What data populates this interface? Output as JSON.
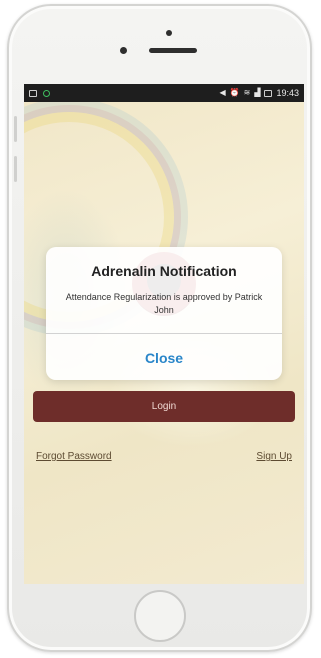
{
  "status_bar": {
    "time": "19:43",
    "left_icons": [
      "image-icon",
      "notification-icon"
    ],
    "right_icons": [
      "volume-icon",
      "alarm-icon",
      "wifi-icon",
      "signal-icon",
      "battery-icon"
    ]
  },
  "dialog": {
    "title": "Adrenalin Notification",
    "message": "Attendance Regularization is approved by Patrick John",
    "close_label": "Close"
  },
  "login": {
    "button_label": "Login",
    "forgot_password_label": "Forgot Password",
    "sign_up_label": "Sign Up"
  },
  "colors": {
    "login_button": "#6e2d2a",
    "dialog_action": "#2a86c9",
    "status_bar": "#1e1e1e"
  }
}
